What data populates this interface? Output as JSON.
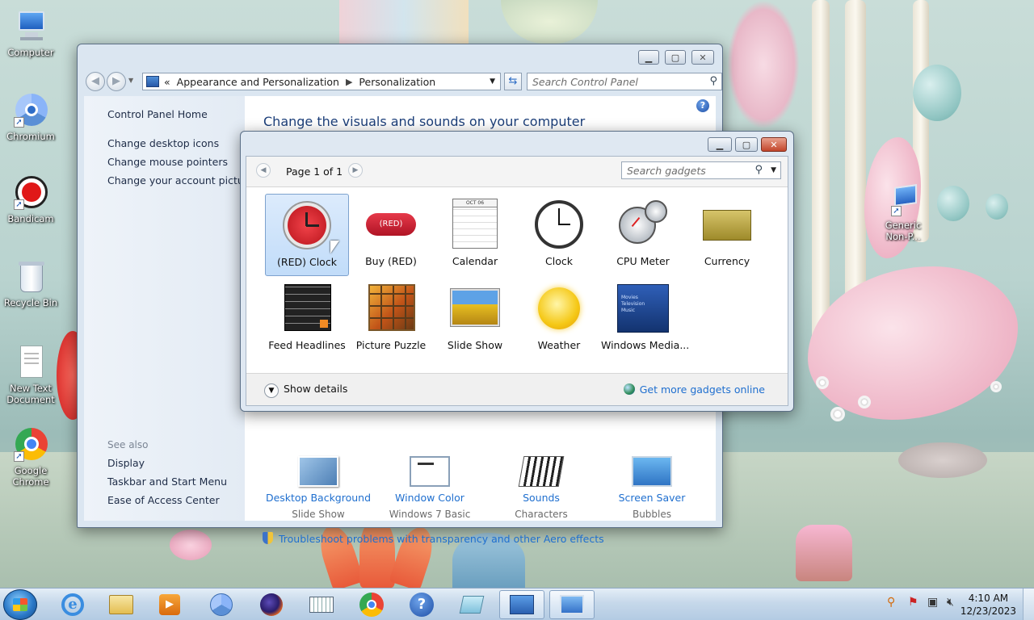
{
  "desktop": {
    "icons": [
      {
        "label": "Computer"
      },
      {
        "label": "Chromium"
      },
      {
        "label": "Bandicam"
      },
      {
        "label": "Recycle Bin"
      },
      {
        "label": "New Text Document"
      },
      {
        "label": "Google Chrome"
      },
      {
        "label": "Generic Non-P..."
      }
    ]
  },
  "control_panel": {
    "breadcrumb": {
      "prefix": "«",
      "parent": "Appearance and Personalization",
      "current": "Personalization"
    },
    "search_placeholder": "Search Control Panel",
    "sidebar": {
      "home": "Control Panel Home",
      "links": [
        "Change desktop icons",
        "Change mouse pointers",
        "Change your account picture"
      ],
      "see_also_title": "See also",
      "see_also": [
        "Display",
        "Taskbar and Start Menu",
        "Ease of Access Center"
      ]
    },
    "title": "Change the visuals and sounds on your computer",
    "items": [
      {
        "label": "Desktop Background",
        "sub": "Slide Show",
        "icon": "desktop-background-icon"
      },
      {
        "label": "Window Color",
        "sub": "Windows 7 Basic",
        "icon": "window-color-icon"
      },
      {
        "label": "Sounds",
        "sub": "Characters",
        "icon": "sounds-icon"
      },
      {
        "label": "Screen Saver",
        "sub": "Bubbles",
        "icon": "screen-saver-icon"
      }
    ],
    "troubleshoot": "Troubleshoot problems with transparency and other Aero effects"
  },
  "gadgets": {
    "page_label": "Page 1 of 1",
    "search_placeholder": "Search gadgets",
    "items": [
      {
        "label": "(RED) Clock",
        "selected": true
      },
      {
        "label": "Buy (RED)"
      },
      {
        "label": "Calendar"
      },
      {
        "label": "Clock"
      },
      {
        "label": "CPU Meter"
      },
      {
        "label": "Currency"
      },
      {
        "label": "Feed Headlines"
      },
      {
        "label": "Picture Puzzle"
      },
      {
        "label": "Slide Show"
      },
      {
        "label": "Weather"
      },
      {
        "label": "Windows Media..."
      }
    ],
    "show_details": "Show details",
    "get_more": "Get more gadgets online",
    "thumb_text": {
      "red_logo": "(RED)",
      "calendar_month": "OCT 06",
      "media_lines": [
        "Movies",
        "Television",
        "Music"
      ]
    }
  },
  "taskbar": {
    "time": "4:10 AM",
    "date": "12/23/2023",
    "apps": [
      "Internet Explorer",
      "Windows Explorer",
      "Media Player",
      "Chromium",
      "Firefox",
      "On-Screen Keyboard",
      "Google Chrome",
      "Help and Support",
      "Notepad",
      "Control Panel",
      "Gadgets"
    ]
  },
  "colors": {
    "link": "#1f6fcf",
    "title_blue": "#1c3f7a",
    "selection": "#c1dcf9",
    "close_red": "#c2452a"
  }
}
